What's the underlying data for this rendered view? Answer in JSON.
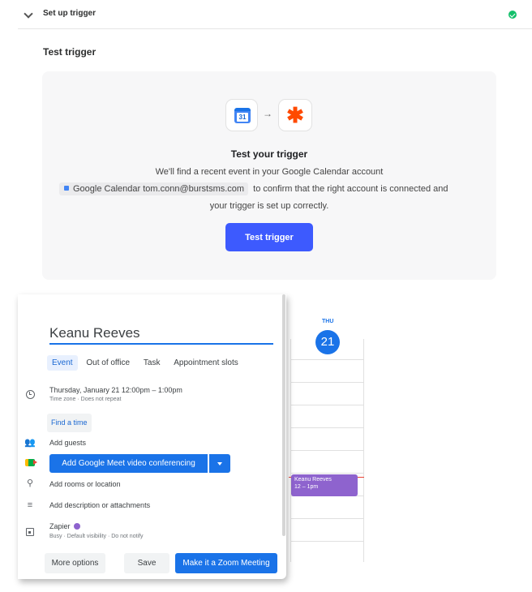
{
  "step": {
    "title": "Set up trigger"
  },
  "section": {
    "title": "Test trigger"
  },
  "test_card": {
    "gcal_day": "31",
    "arrow": "→",
    "zap_glyph": "✱",
    "heading": "Test your trigger",
    "line1": "We'll find a recent event in your Google Calendar account",
    "account_chip": "Google Calendar tom.conn@burstsms.com",
    "line2_rest": "to confirm that the right account is connected and",
    "line3": "your trigger is set up correctly.",
    "button": "Test trigger"
  },
  "event_panel": {
    "title": "Keanu Reeves",
    "tabs": [
      "Event",
      "Out of office",
      "Task",
      "Appointment slots"
    ],
    "date_time": "Thursday, January 21   12:00pm  –  1:00pm",
    "date_sub": "Time zone · Does not repeat",
    "find_time": "Find a time",
    "add_guests": "Add guests",
    "meet_button": "Add Google Meet video conferencing",
    "add_rooms": "Add rooms or location",
    "add_description": "Add description or attachments",
    "calendar_name": "Zapier",
    "calendar_sub": "Busy · Default visibility · Do not notify",
    "more_options": "More options",
    "save": "Save",
    "zoom": "Make it a Zoom Meeting"
  },
  "calendar_grid": {
    "day_label": "THU",
    "day_number": "21",
    "event_title": "Keanu Reeves",
    "event_time": "12 – 1pm"
  },
  "icons": {
    "pin": "⚲",
    "guests": "👥",
    "description": "≡"
  },
  "colors": {
    "zapier_orange": "#ff4a00",
    "primary_button": "#3d5afe",
    "google_blue": "#1a73e8",
    "event_purple": "#8e63ce",
    "success_green": "#13c06a"
  }
}
